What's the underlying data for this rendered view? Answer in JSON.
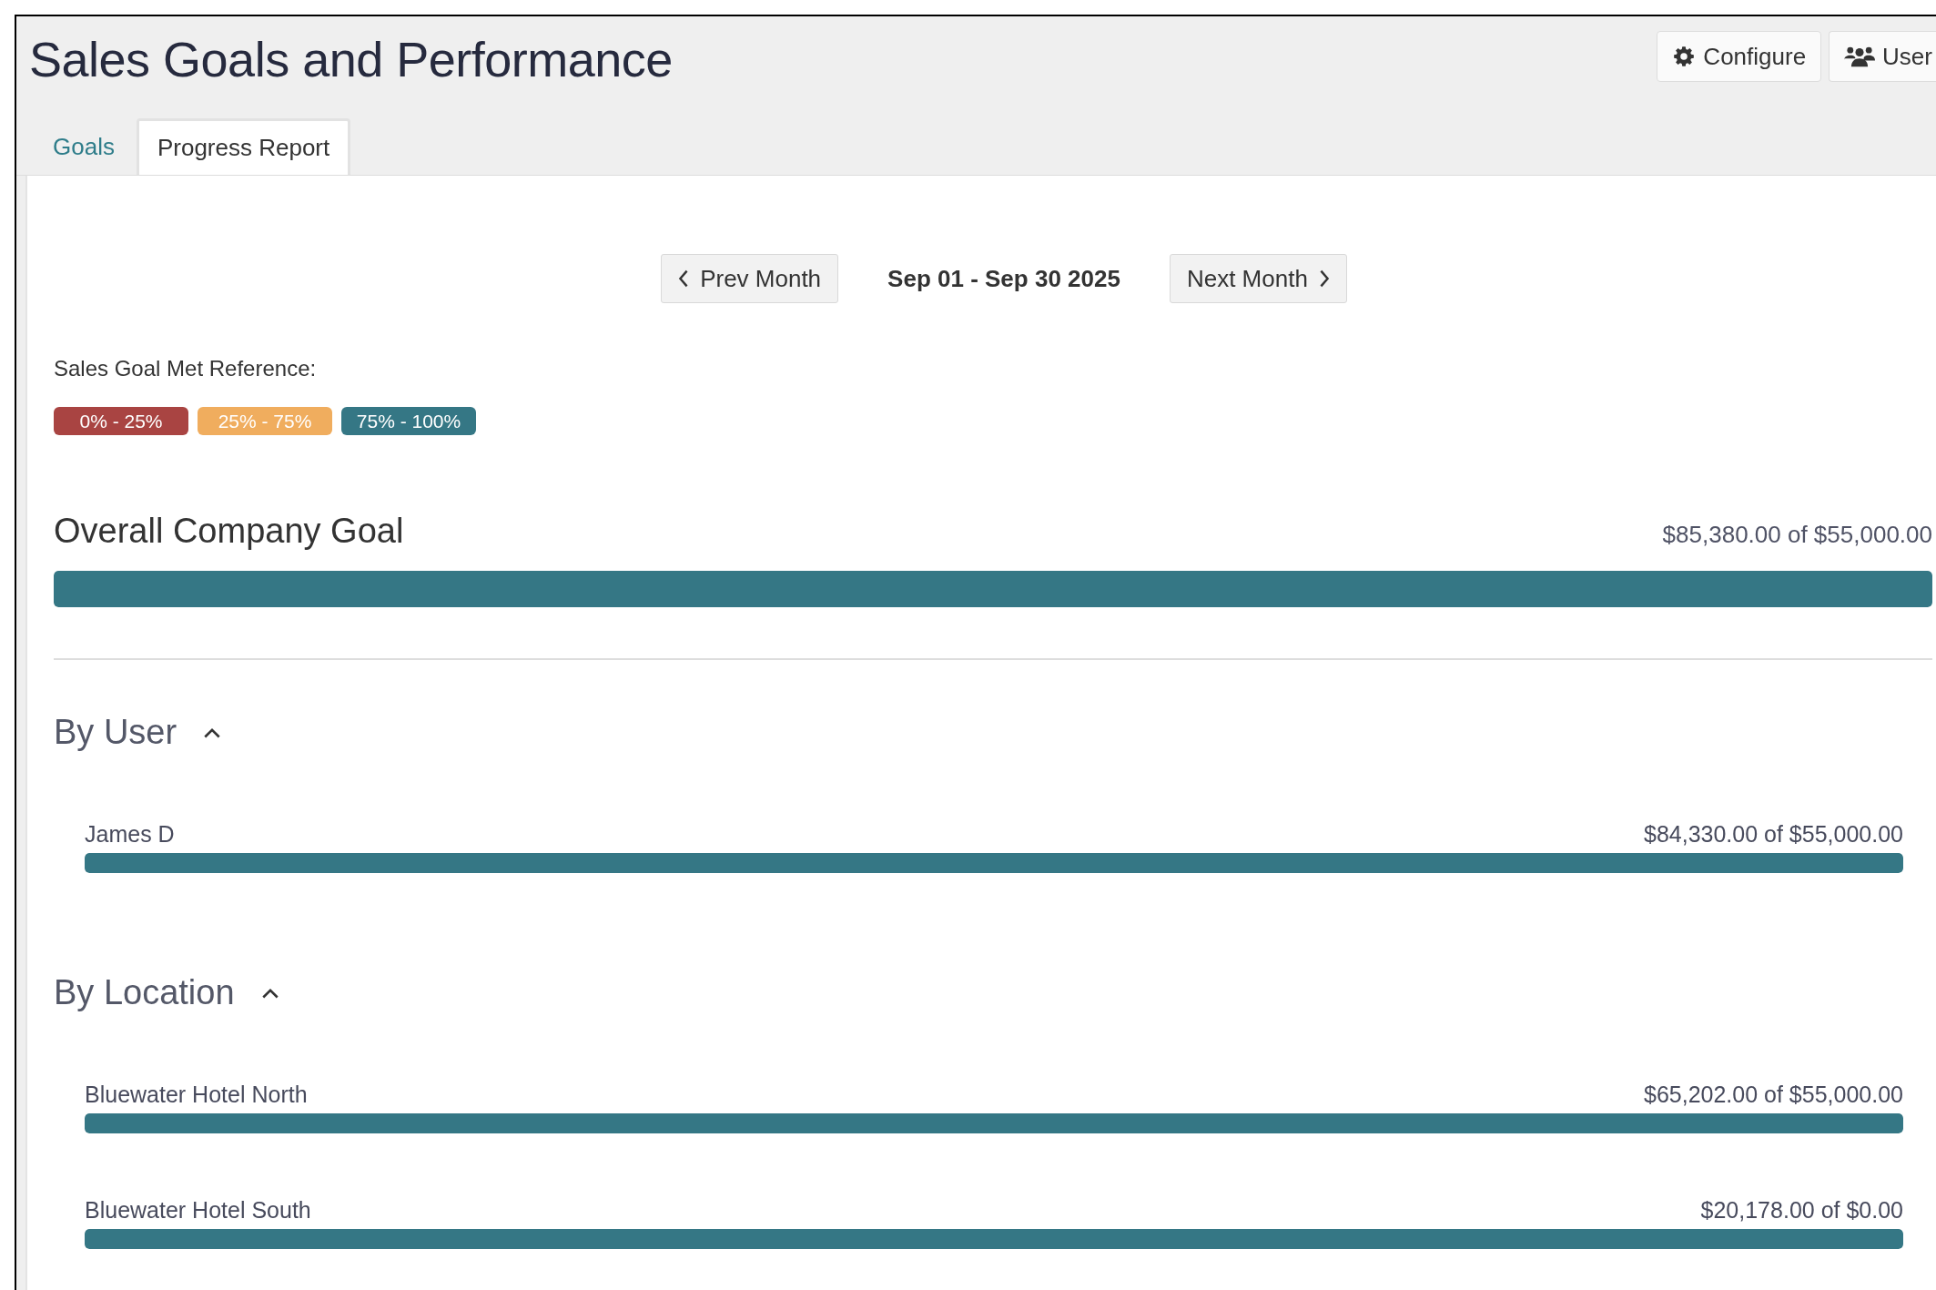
{
  "title": "Sales Goals and Performance",
  "header_buttons": [
    {
      "label": "Configure",
      "kind": "gear"
    },
    {
      "label": "User",
      "kind": "users"
    }
  ],
  "tabs": [
    {
      "label": "Goals",
      "selected": false
    },
    {
      "label": "Progress Report",
      "selected": true
    }
  ],
  "period": {
    "prev": "Prev Month",
    "range": "Sep 01 - Sep 30 2025",
    "next": "Next Month"
  },
  "legend": {
    "label": "Sales Goal Met Reference:",
    "items": [
      {
        "label": "0% - 25%",
        "color": "#a94442"
      },
      {
        "label": "25% - 75%",
        "color": "#f0ad5e"
      },
      {
        "label": "75% - 100%",
        "color": "#357785"
      }
    ]
  },
  "overall": {
    "title": "Overall Company Goal",
    "amount": "$85,380.00 of $55,000.00",
    "level": 1
  },
  "sections": [
    {
      "title": "By User",
      "expanded": true,
      "rows": [
        {
          "name": "James D",
          "amount": "$84,330.00 of $55,000.00",
          "level": 1
        }
      ]
    },
    {
      "title": "By Location",
      "expanded": true,
      "rows": [
        {
          "name": "Bluewater Hotel North",
          "amount": "$65,202.00 of $55,000.00",
          "level": 1
        },
        {
          "name": "Bluewater Hotel South",
          "amount": "$20,178.00 of $0.00",
          "level": 1
        }
      ]
    }
  ]
}
